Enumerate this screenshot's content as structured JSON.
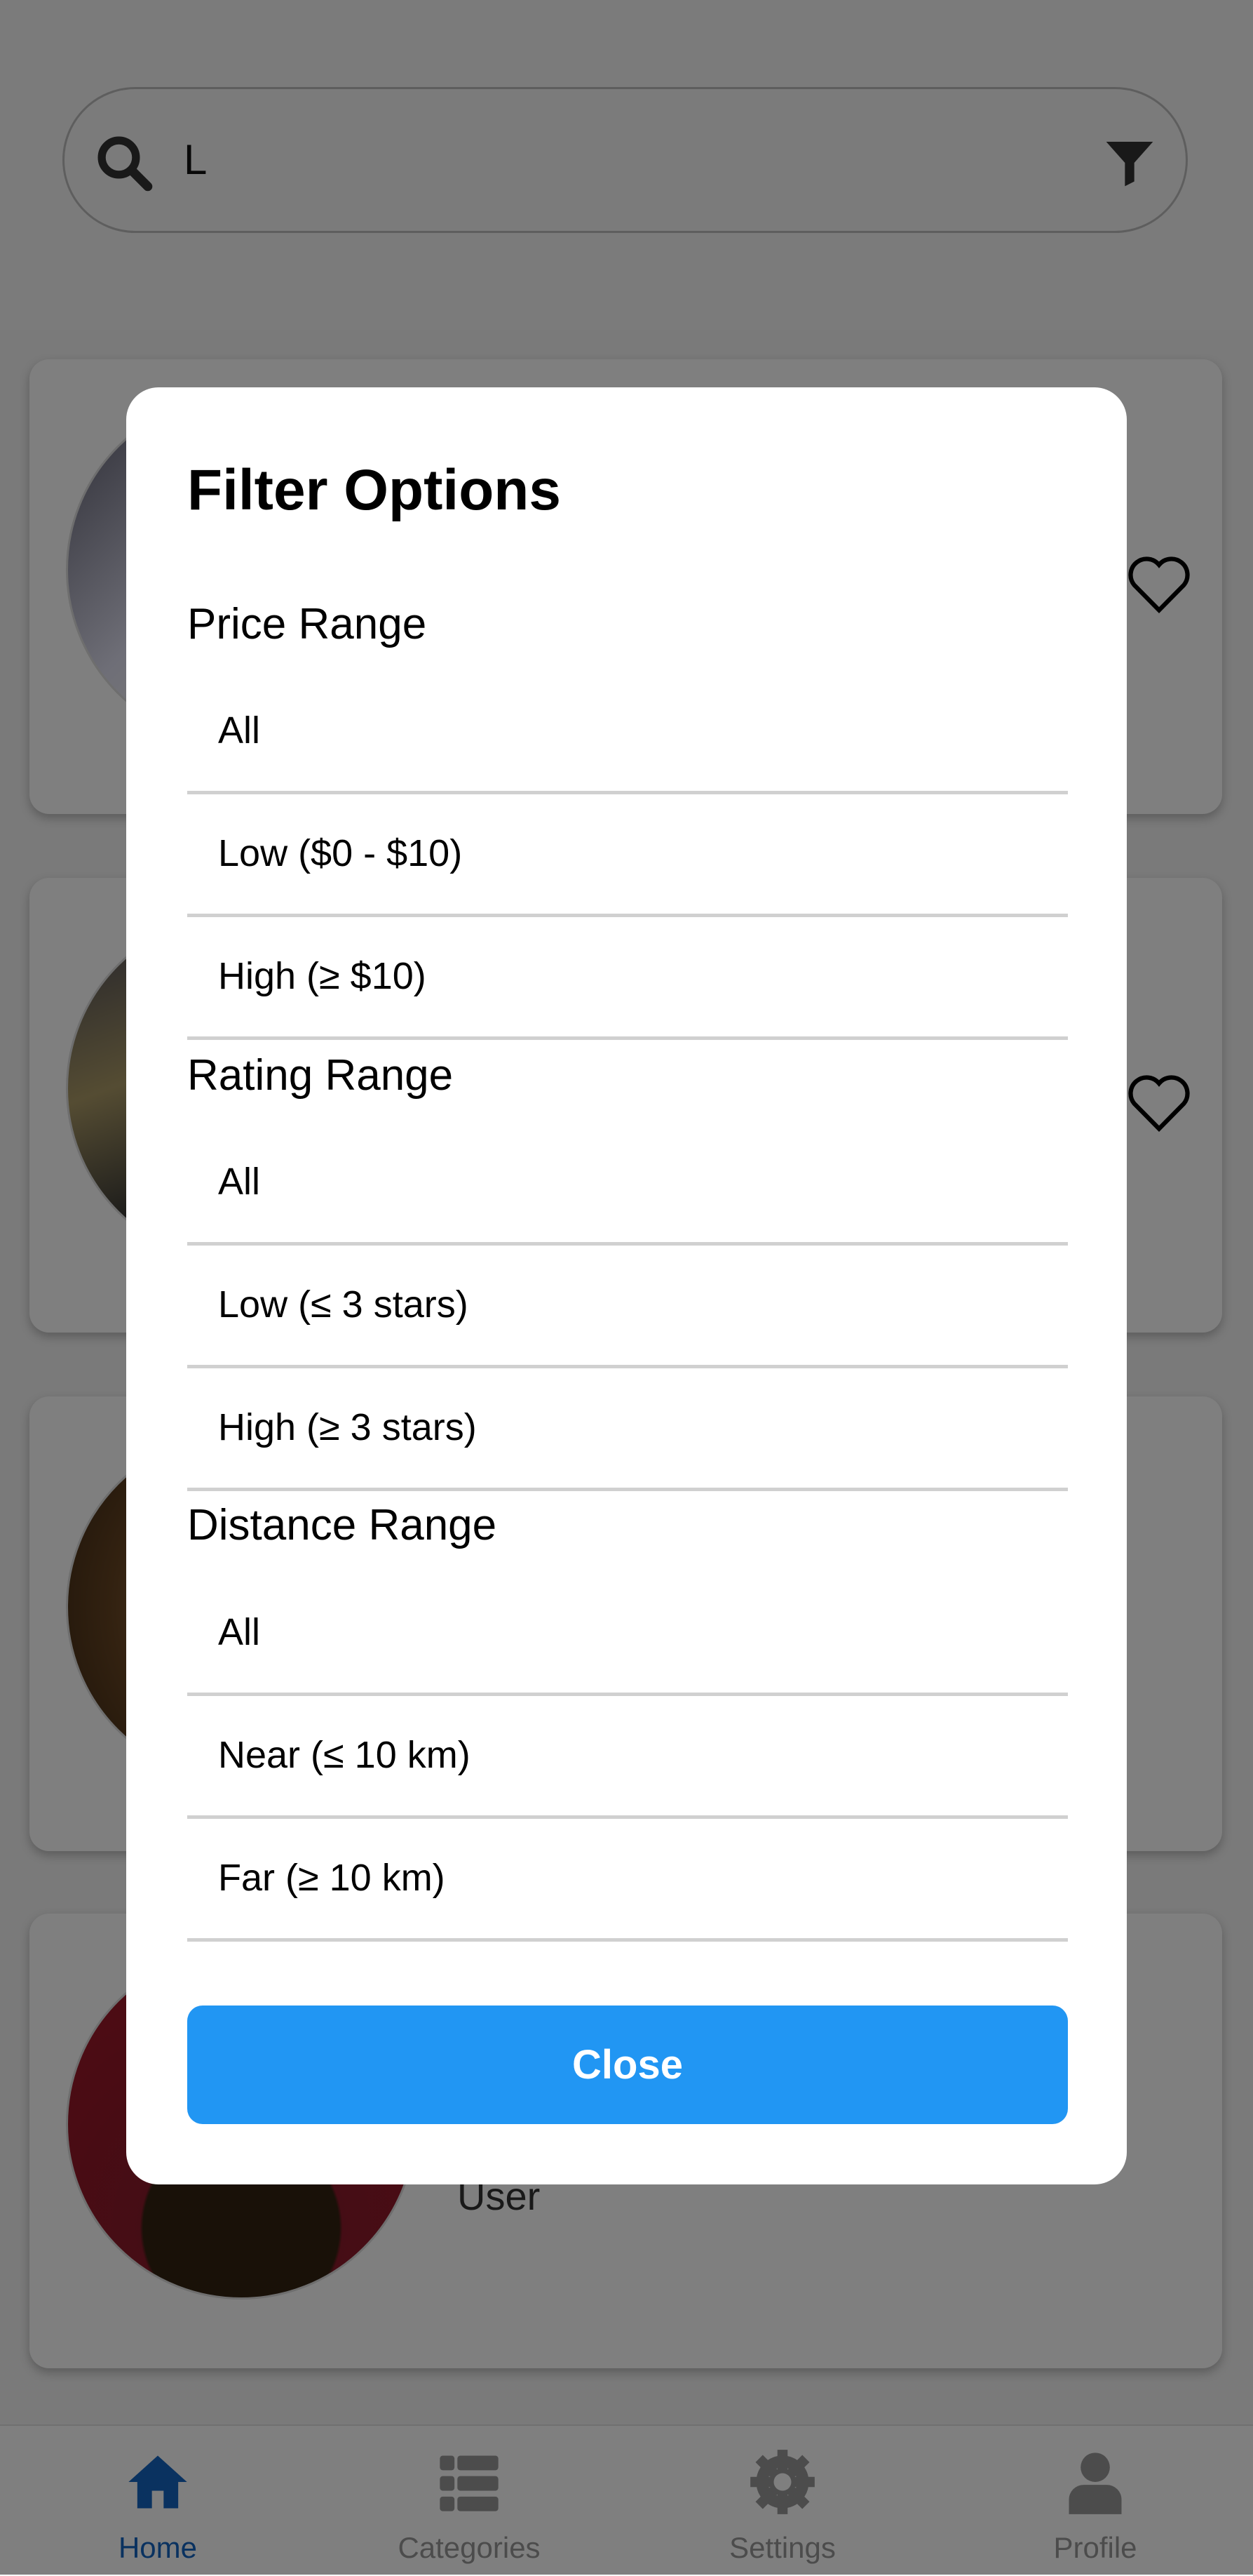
{
  "search": {
    "value": "L",
    "search_icon": "search-icon",
    "filter_icon": "filter-icon"
  },
  "cards": [
    {
      "favorite_icon": "heart-outline-icon"
    },
    {
      "favorite_icon": "heart-outline-icon"
    },
    {},
    {
      "subtitle": "User"
    }
  ],
  "modal": {
    "title": "Filter Options",
    "sections": [
      {
        "label": "Price Range",
        "options": [
          "All",
          "Low ($0 - $10)",
          "High (≥ $10)"
        ]
      },
      {
        "label": "Rating Range",
        "options": [
          "All",
          "Low (≤ 3 stars)",
          "High (≥ 3 stars)"
        ]
      },
      {
        "label": "Distance Range",
        "options": [
          "All",
          "Near (≤ 10 km)",
          "Far (≥ 10 km)"
        ]
      }
    ],
    "close_label": "Close"
  },
  "nav": {
    "active": "Home",
    "items": [
      {
        "label": "Home",
        "icon": "home-icon"
      },
      {
        "label": "Categories",
        "icon": "list-icon"
      },
      {
        "label": "Settings",
        "icon": "gear-icon"
      },
      {
        "label": "Profile",
        "icon": "user-icon"
      }
    ]
  },
  "colors": {
    "accent": "#2196F3",
    "nav_active": "#0d47a1",
    "overlay": "rgba(0,0,0,0.5)"
  }
}
